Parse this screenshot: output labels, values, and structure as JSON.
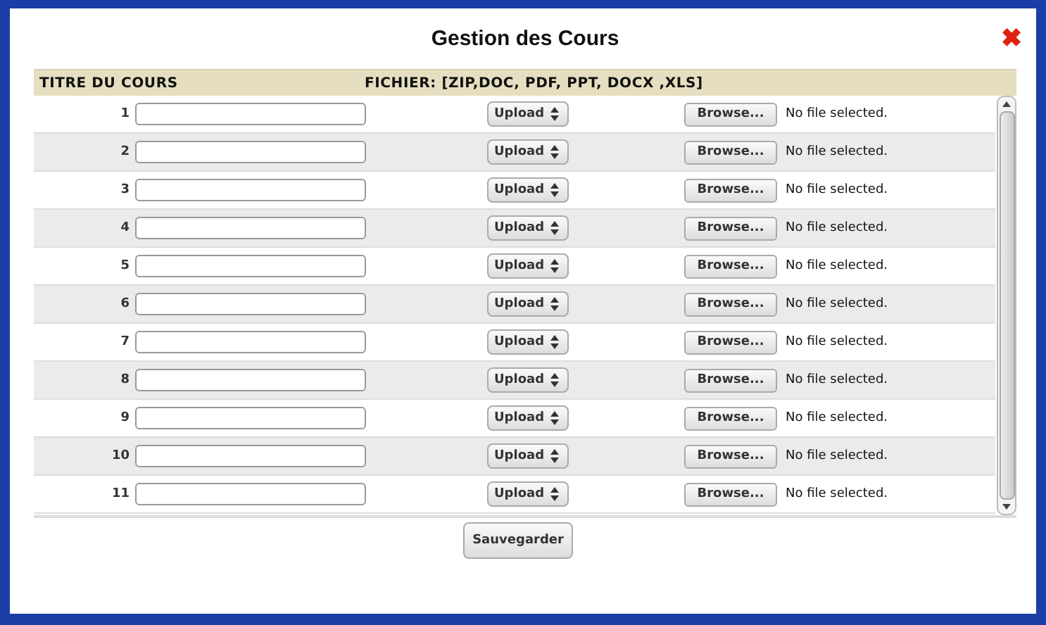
{
  "dialog": {
    "title": "Gestion des Cours",
    "close": "✖"
  },
  "table": {
    "columns": [
      "TITRE DU COURS",
      "FICHIER: [ZIP,DOC, PDF, PPT, DOCX ,XLS]"
    ],
    "rows": [
      {
        "number": "1",
        "upload": "Upload",
        "browse": "Browse...",
        "file_status": "No file selected."
      },
      {
        "number": "2",
        "upload": "Upload",
        "browse": "Browse...",
        "file_status": "No file selected."
      },
      {
        "number": "3",
        "upload": "Upload",
        "browse": "Browse...",
        "file_status": "No file selected."
      },
      {
        "number": "4",
        "upload": "Upload",
        "browse": "Browse...",
        "file_status": "No file selected."
      },
      {
        "number": "5",
        "upload": "Upload",
        "browse": "Browse...",
        "file_status": "No file selected."
      },
      {
        "number": "6",
        "upload": "Upload",
        "browse": "Browse...",
        "file_status": "No file selected."
      },
      {
        "number": "7",
        "upload": "Upload",
        "browse": "Browse...",
        "file_status": "No file selected."
      },
      {
        "number": "8",
        "upload": "Upload",
        "browse": "Browse...",
        "file_status": "No file selected."
      },
      {
        "number": "9",
        "upload": "Upload",
        "browse": "Browse...",
        "file_status": "No file selected."
      },
      {
        "number": "10",
        "upload": "Upload",
        "browse": "Browse...",
        "file_status": "No file selected."
      },
      {
        "number": "11",
        "upload": "Upload",
        "browse": "Browse...",
        "file_status": "No file selected."
      }
    ]
  },
  "save_button": "Sauvegarder"
}
